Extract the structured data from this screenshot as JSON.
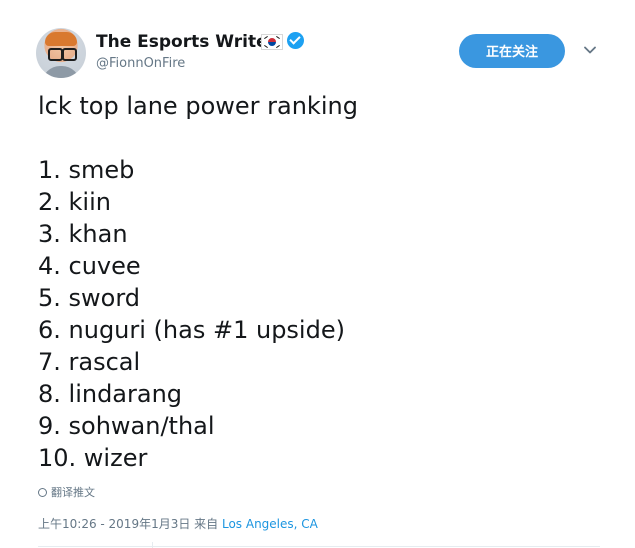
{
  "author": {
    "display_name": "The Esports Writer",
    "handle": "@FionnOnFire",
    "flag_icon": "south-korea-flag-icon",
    "verified_icon": "verified-badge-icon"
  },
  "actions": {
    "follow_label": "正在关注",
    "more_icon": "chevron-down-icon"
  },
  "tweet": {
    "title": "lck top lane power ranking",
    "ranking": [
      "1. smeb",
      "2. kiin",
      "3. khan",
      "4. cuvee",
      "5. sword",
      "6. nuguri (has #1 upside)",
      "7. rascal",
      "8. lindarang",
      "9. sohwan/thal",
      "10. wizer"
    ]
  },
  "translate_label": "翻译推文",
  "meta": {
    "timestamp": "上午10:26 - 2019年1月3日 来自 ",
    "location": "Los Angeles, CA"
  },
  "colors": {
    "accent": "#1da1f2",
    "button": "#3a97e0",
    "secondary_text": "#657786",
    "link": "#1b95e0"
  }
}
